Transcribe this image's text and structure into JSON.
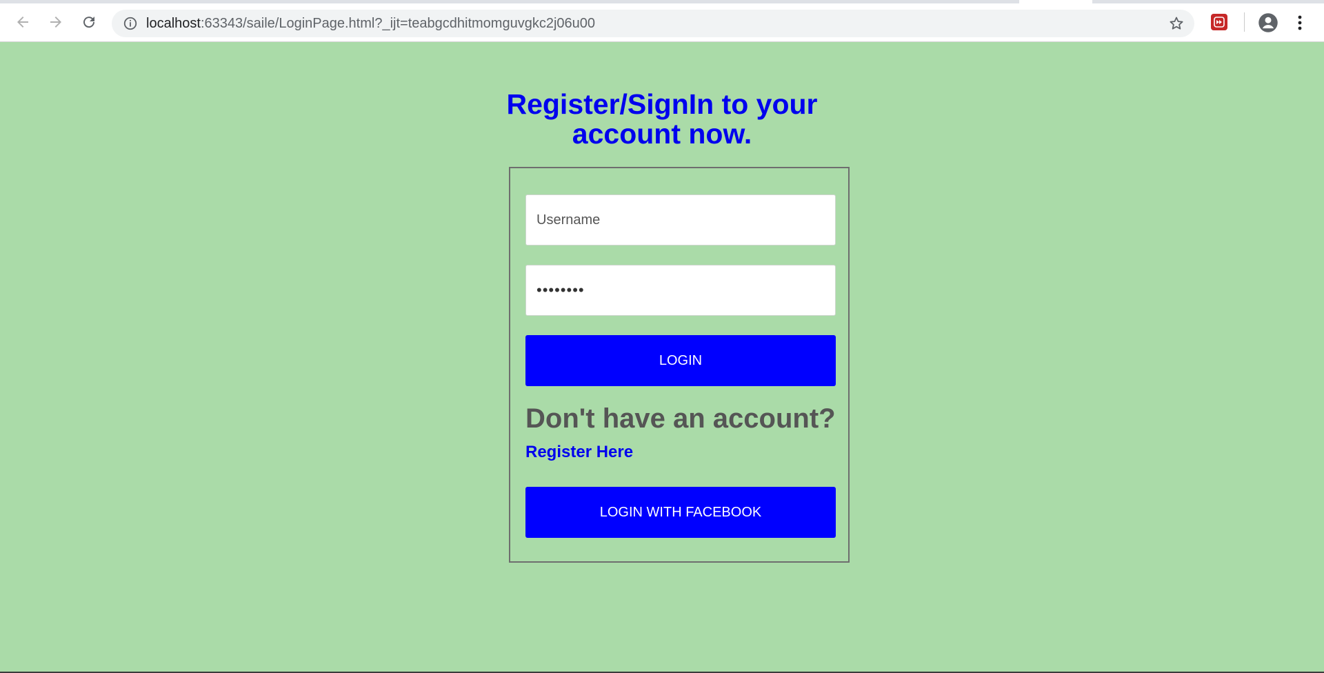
{
  "browser": {
    "url_host": "localhost",
    "url_path": ":63343/saile/LoginPage.html?_ijt=teabgcdhitmomguvgkc2j06u00",
    "icons": [
      "back-arrow-icon",
      "forward-arrow-icon",
      "reload-icon",
      "info-icon",
      "star-icon",
      "extension-icon",
      "profile-icon",
      "menu-dots-icon"
    ]
  },
  "page": {
    "heading": "Register/SignIn to your account now.",
    "username_placeholder": "Username",
    "password_value": "••••••••",
    "login_label": "LOGIN",
    "no_account_text": "Don't have an account?",
    "register_link": "Register Here",
    "facebook_label": "LOGIN WITH FACEBOOK"
  },
  "colors": {
    "background": "#aadba8",
    "accent": "#0000ff",
    "heading": "#0000ee",
    "prompt_text": "#555555"
  }
}
